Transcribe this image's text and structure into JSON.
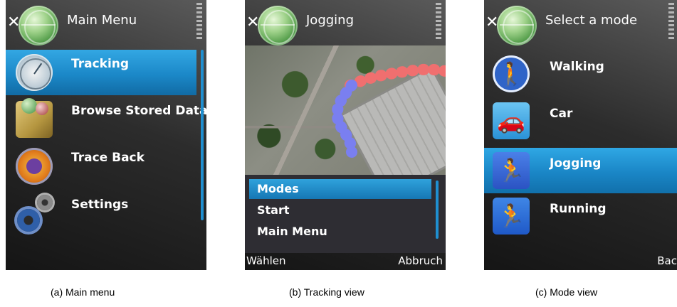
{
  "screens": {
    "main_menu": {
      "title": "Main Menu",
      "items": [
        {
          "label": "Tracking",
          "icon": "radar-icon",
          "selected": true
        },
        {
          "label": "Browse Stored Data",
          "icon": "browse-data-icon",
          "selected": false
        },
        {
          "label": "Trace Back",
          "icon": "trace-back-icon",
          "selected": false
        },
        {
          "label": "Settings",
          "icon": "gear-icon",
          "selected": false
        }
      ]
    },
    "tracking": {
      "title": "Jogging",
      "menu": [
        {
          "label": "Modes",
          "selected": true
        },
        {
          "label": "Start",
          "selected": false
        },
        {
          "label": "Main Menu",
          "selected": false
        }
      ],
      "softkeys": {
        "left": "Wählen",
        "right": "Abbruch"
      },
      "trail_colors": {
        "recorded": "#7a7ff0",
        "trace": "#f06f6f"
      }
    },
    "mode_select": {
      "title": "Select a mode",
      "items": [
        {
          "label": "Walking",
          "icon": "walking-icon",
          "selected": false
        },
        {
          "label": "Car",
          "icon": "car-icon",
          "selected": false
        },
        {
          "label": "Jogging",
          "icon": "jogging-icon",
          "selected": true
        },
        {
          "label": "Running",
          "icon": "running-icon",
          "selected": false
        }
      ],
      "softkeys": {
        "right": "Bac"
      }
    }
  },
  "captions": {
    "a": "(a) Main menu",
    "b": "(b) Tracking view",
    "c": "(c) Mode view"
  },
  "colors": {
    "selection_blue": "#1b88c8",
    "background_dark": "#2c2c2c"
  }
}
